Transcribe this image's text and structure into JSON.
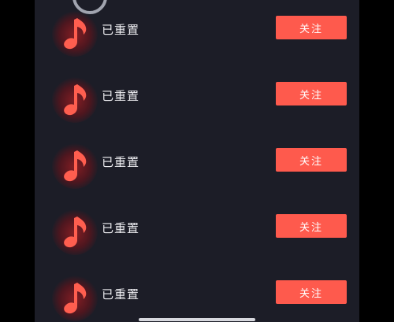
{
  "list": {
    "items": [
      {
        "name": "已重置",
        "follow_label": "关注",
        "avatar_icon": "music-note-icon"
      },
      {
        "name": "已重置",
        "follow_label": "关注",
        "avatar_icon": "music-note-icon"
      },
      {
        "name": "已重置",
        "follow_label": "关注",
        "avatar_icon": "music-note-icon"
      },
      {
        "name": "已重置",
        "follow_label": "关注",
        "avatar_icon": "music-note-icon"
      },
      {
        "name": "已重置",
        "follow_label": "关注",
        "avatar_icon": "music-note-icon"
      }
    ]
  },
  "colors": {
    "background": "#1c1d27",
    "accent": "#fe5a4d",
    "text": "#eeeef2"
  }
}
